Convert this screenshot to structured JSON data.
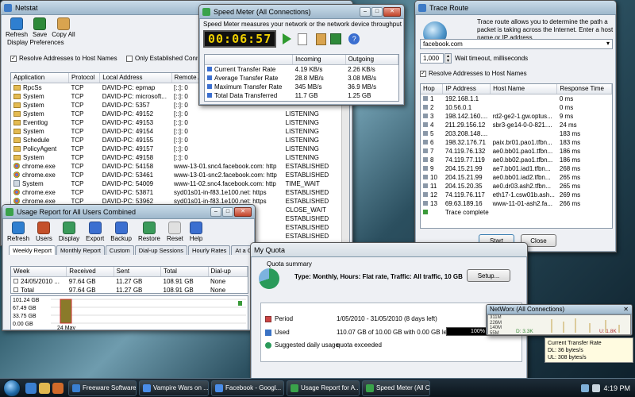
{
  "colors": {
    "accent": "#1a6fc1",
    "lcd_bg": "#101010",
    "lcd_fg": "#f0d000",
    "bar_fill": "#8a7a2a",
    "progress": "#000000",
    "graph_bg": "#f4f4ec"
  },
  "netstat": {
    "title": "Netstat",
    "toolbar": [
      {
        "label": "Refresh",
        "icon": "refresh-icon"
      },
      {
        "label": "Save",
        "icon": "save-icon"
      },
      {
        "label": "Copy All",
        "icon": "copy-icon"
      }
    ],
    "prefs_label": "Display Preferences",
    "resolve_label": "Resolve Addresses to Host Names",
    "established_label": "Only Established Connections",
    "headers": [
      "Application",
      "Protocol",
      "Local Address",
      "Remote Address",
      "State"
    ],
    "rows": [
      {
        "icon": "folder",
        "app": "RpcSs",
        "proto": "TCP",
        "local": "DAVID-PC: epmap",
        "remote": "[::]: 0",
        "state": ""
      },
      {
        "icon": "folder",
        "app": "System",
        "proto": "TCP",
        "local": "DAVID-PC: microsoft...",
        "remote": "[::]: 0",
        "state": ""
      },
      {
        "icon": "folder",
        "app": "System",
        "proto": "TCP",
        "local": "DAVID-PC: 5357",
        "remote": "[::]: 0",
        "state": ""
      },
      {
        "icon": "folder",
        "app": "System",
        "proto": "TCP",
        "local": "DAVID-PC: 49152",
        "remote": "[::]: 0",
        "state": "LISTENING"
      },
      {
        "icon": "folder",
        "app": "Eventlog",
        "proto": "TCP",
        "local": "DAVID-PC: 49153",
        "remote": "[::]: 0",
        "state": "LISTENING"
      },
      {
        "icon": "folder",
        "app": "System",
        "proto": "TCP",
        "local": "DAVID-PC: 49154",
        "remote": "[::]: 0",
        "state": "LISTENING"
      },
      {
        "icon": "folder",
        "app": "Schedule",
        "proto": "TCP",
        "local": "DAVID-PC: 49155",
        "remote": "[::]: 0",
        "state": "LISTENING"
      },
      {
        "icon": "folder",
        "app": "PolicyAgent",
        "proto": "TCP",
        "local": "DAVID-PC: 49157",
        "remote": "[::]: 0",
        "state": "LISTENING"
      },
      {
        "icon": "folder",
        "app": "System",
        "proto": "TCP",
        "local": "DAVID-PC: 49158",
        "remote": "[::]: 0",
        "state": "LISTENING"
      },
      {
        "icon": "chrome",
        "app": "chrome.exe",
        "proto": "TCP",
        "local": "DAVID-PC: 54158",
        "remote": "www-13-01.snc4.facebook.com: http",
        "state": "ESTABLISHED"
      },
      {
        "icon": "chrome",
        "app": "chrome.exe",
        "proto": "TCP",
        "local": "DAVID-PC: 53461",
        "remote": "www-13-01-snc2.facebook.com: http",
        "state": "ESTABLISHED"
      },
      {
        "icon": "system",
        "app": "System",
        "proto": "TCP",
        "local": "DAVID-PC: 54009",
        "remote": "www-11-02.snc4.facebook.com: http",
        "state": "TIME_WAIT"
      },
      {
        "icon": "chrome",
        "app": "chrome.exe",
        "proto": "TCP",
        "local": "DAVID-PC: 53871",
        "remote": "syd01s01-in-f83.1e100.net: https",
        "state": "ESTABLISHED"
      },
      {
        "icon": "chrome",
        "app": "chrome.exe",
        "proto": "TCP",
        "local": "DAVID-PC: 53962",
        "remote": "syd01s01-in-f83.1e100.net: https",
        "state": "ESTABLISHED"
      },
      {
        "icon": "none",
        "app": "",
        "proto": "",
        "local": "",
        "remote": "",
        "state": "CLOSE_WAIT"
      },
      {
        "icon": "none",
        "app": "",
        "proto": "",
        "local": "",
        "remote": "",
        "state": "ESTABLISHED"
      },
      {
        "icon": "none",
        "app": "",
        "proto": "",
        "local": "",
        "remote": "",
        "state": "ESTABLISHED"
      },
      {
        "icon": "none",
        "app": "",
        "proto": "",
        "local": "",
        "remote": "",
        "state": "ESTABLISHED"
      },
      {
        "icon": "none",
        "app": "",
        "proto": "",
        "local": "",
        "remote": "",
        "state": "TIME_WAIT"
      },
      {
        "icon": "none",
        "app": "",
        "proto": "",
        "local": "",
        "remote": "",
        "state": "ESTABLISHED"
      }
    ]
  },
  "speed": {
    "title": "Speed Meter (All Connections)",
    "description": "Speed Meter measures your network or the network device throughput",
    "timer": "00:06:57",
    "headers": [
      "",
      "Incoming",
      "Outgoing"
    ],
    "rows": [
      {
        "label": "Current Transfer Rate",
        "in": "4.19 KB/s",
        "out": "2.26 KB/s"
      },
      {
        "label": "Average Transfer Rate",
        "in": "28.8 MB/s",
        "out": "3.08 MB/s"
      },
      {
        "label": "Maximum Transfer Rate",
        "in": "345 MB/s",
        "out": "36.9 MB/s"
      },
      {
        "label": "Total Data Transferred",
        "in": "11.7 GB",
        "out": "1.25 GB"
      }
    ]
  },
  "trace": {
    "title": "Trace Route",
    "description": "Trace route allows you to determine the path a packet is taking across the Internet. Enter a host name or IP address.",
    "host": "facebook.com",
    "timeout": "1,000",
    "timeout_label": "Wait timeout, milliseconds",
    "resolve_label": "Resolve Addresses to Host Names",
    "headers": [
      "Hop",
      "IP Address",
      "Host Name",
      "Response Time"
    ],
    "rows": [
      {
        "hop": "1",
        "ip": "192.168.1.1",
        "host": "",
        "time": "0 ms"
      },
      {
        "hop": "2",
        "ip": "10.56.0.1",
        "host": "",
        "time": "0 ms"
      },
      {
        "hop": "3",
        "ip": "198.142.160....",
        "host": "rd2-ge2-1.gw.optus...",
        "time": "9 ms"
      },
      {
        "hop": "4",
        "ip": "211.29.156.12",
        "host": "sbr3-ge14-0-0-821....",
        "time": "24 ms"
      },
      {
        "hop": "5",
        "ip": "203.208.148....",
        "host": "",
        "time": "183 ms"
      },
      {
        "hop": "6",
        "ip": "198.32.176.71",
        "host": "paix.br01.pao1.tfbn...",
        "time": "183 ms"
      },
      {
        "hop": "7",
        "ip": "74.119.76.132",
        "host": "ae0.bb01.pao1.tfbn...",
        "time": "186 ms"
      },
      {
        "hop": "8",
        "ip": "74.119.77.119",
        "host": "ae0.bb02.pao1.tfbn...",
        "time": "186 ms"
      },
      {
        "hop": "9",
        "ip": "204.15.21.99",
        "host": "ae7.bb01.iad1.tfbn...",
        "time": "268 ms"
      },
      {
        "hop": "10",
        "ip": "204.15.21.99",
        "host": "ae0.bb01.iad2.tfbn...",
        "time": "265 ms"
      },
      {
        "hop": "11",
        "ip": "204.15.20.35",
        "host": "ae0.dr03.ash2.tfbn...",
        "time": "265 ms"
      },
      {
        "hop": "12",
        "ip": "74.119.76.117",
        "host": "eth17-1.csw01b.ash...",
        "time": "269 ms"
      },
      {
        "hop": "13",
        "ip": "69.63.189.16",
        "host": "www-11-01-ash2.fa...",
        "time": "266 ms"
      },
      {
        "hop": "",
        "ip": "Trace complete",
        "host": "",
        "time": ""
      }
    ],
    "start_label": "Start",
    "close_label": "Close"
  },
  "usage": {
    "title": "Usage Report for All Users Combined",
    "toolbar": [
      {
        "label": "Refresh",
        "icon": "refresh-icon"
      },
      {
        "label": "Users",
        "icon": "users-icon"
      },
      {
        "label": "Display",
        "icon": "display-icon"
      },
      {
        "label": "Export",
        "icon": "export-icon"
      },
      {
        "label": "Backup",
        "icon": "backup-icon"
      },
      {
        "label": "Restore",
        "icon": "restore-icon"
      },
      {
        "label": "Reset",
        "icon": "reset-icon"
      },
      {
        "label": "Help",
        "icon": "help-icon"
      }
    ],
    "tabs": [
      "Weekly Report",
      "Monthly Report",
      "Custom",
      "Dial-up Sessions",
      "Hourly Rates",
      "At a Glance"
    ],
    "headers": [
      "Week",
      "Received",
      "Sent",
      "Total",
      "Dial-up"
    ],
    "rows": [
      {
        "week": "24/05/2010 ...",
        "received": "97.64 GB",
        "sent": "11.27 GB",
        "total": "108.91 GB",
        "dialup": "None"
      },
      {
        "week": "Total",
        "received": "97.64 GB",
        "sent": "11.27 GB",
        "total": "108.91 GB",
        "dialup": "None"
      }
    ],
    "y_ticks": [
      "101.24 GB",
      "67.49 GB",
      "33.75 GB",
      "0.00 GB"
    ],
    "bar_label": "24 May"
  },
  "chart_data": {
    "type": "bar",
    "categories": [
      "24 May"
    ],
    "values": [
      108.91
    ],
    "title": "",
    "xlabel": "",
    "ylabel": "",
    "ylim": [
      0,
      101.24
    ]
  },
  "quota": {
    "title": "My Quota",
    "summary_label": "Quota summary",
    "plan": "Type: Monthly, Hours: Flat rate, Traffic: All traffic, 10 GB",
    "setup_label": "Setup...",
    "period_label": "Period",
    "period": "1/05/2010 - 31/05/2010 (8 days left)",
    "used_label": "Used",
    "used": "110.07 GB of 10.00 GB with 0.00 GB left",
    "percent": "100%",
    "percent_value": 100,
    "suggested_label": "Suggested daily usage",
    "suggested": "quota exceeded"
  },
  "networx": {
    "title": "NetWorx (All Connections)",
    "y_ticks": [
      "311M",
      "226M",
      "140M",
      "55M"
    ],
    "download": "D: 3.3K",
    "upload": "U: 1.8K",
    "tooltip_title": "Current Transfer Rate",
    "tooltip_dl": "DL: 36 bytes/s",
    "tooltip_ul": "UL: 308 bytes/s"
  },
  "taskbar": {
    "tasks": [
      "Freeware Software...",
      "Vampire Wars on ...",
      "Facebook - Googl...",
      "Usage Report for A...",
      "Speed Meter (All C..."
    ],
    "time": "4:19 PM"
  }
}
